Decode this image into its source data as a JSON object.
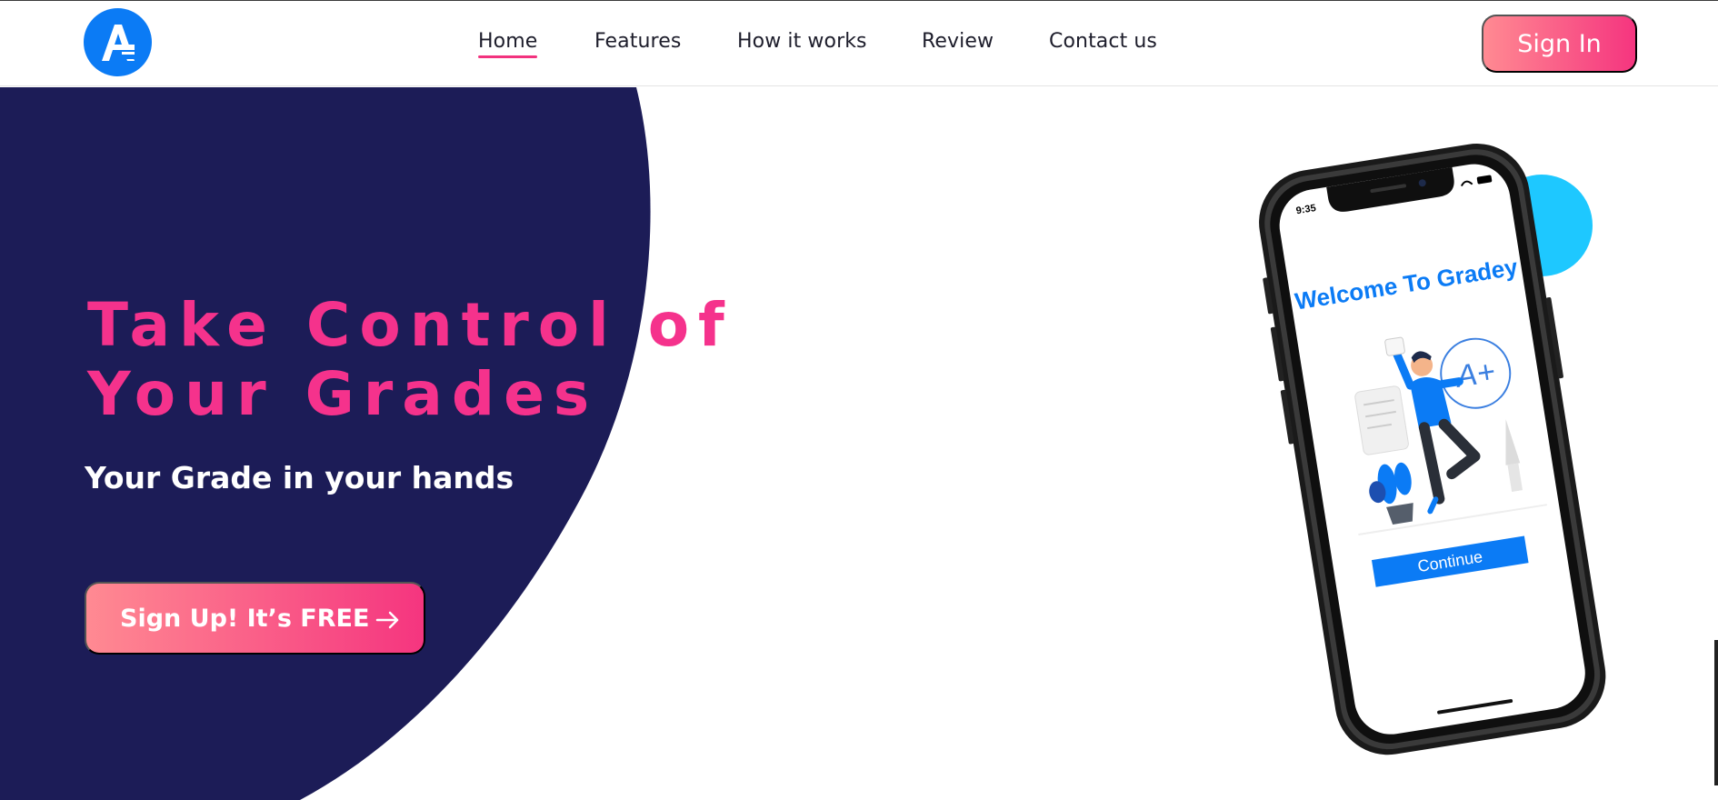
{
  "nav": {
    "logo_icon": "gradey-a-logo-icon",
    "links": [
      {
        "label": "Home",
        "active": true
      },
      {
        "label": "Features",
        "active": false
      },
      {
        "label": "How it works",
        "active": false
      },
      {
        "label": "Review",
        "active": false
      },
      {
        "label": "Contact us",
        "active": false
      }
    ],
    "signin_label": "Sign In"
  },
  "hero": {
    "headline_line1": "Take Control of",
    "headline_line2": "Your Grades",
    "subheadline": "Your Grade in your hands",
    "cta_label": "Sign Up! It’s FREE",
    "cta_icon": "arrow-right-icon"
  },
  "phone": {
    "status_time": "9:35",
    "screen_title": "Welcome To Gradey",
    "button_label": "Continue",
    "illustration_text": "A+"
  },
  "colors": {
    "navy": "#1c1c57",
    "pink": "#f5328c",
    "blue": "#0b7bf5",
    "cyan": "#1ec8ff"
  }
}
